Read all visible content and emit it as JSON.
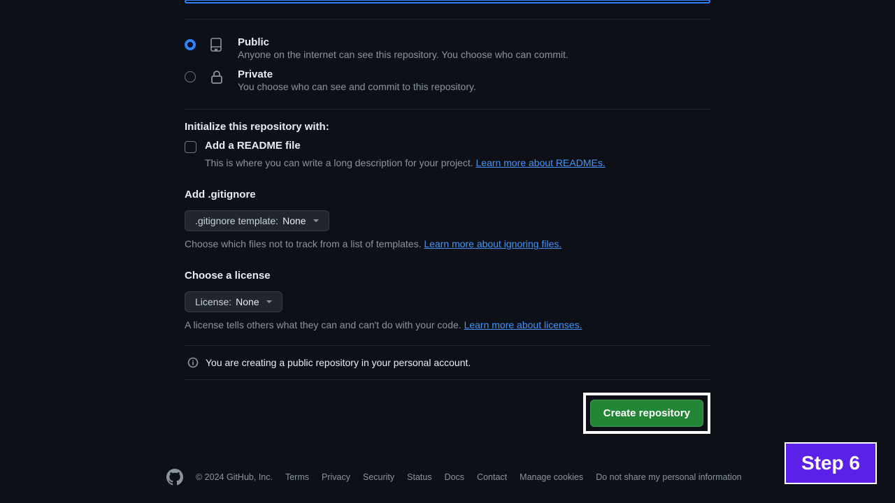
{
  "visibility": {
    "public": {
      "title": "Public",
      "desc": "Anyone on the internet can see this repository. You choose who can commit."
    },
    "private": {
      "title": "Private",
      "desc": "You choose who can see and commit to this repository."
    }
  },
  "init": {
    "heading": "Initialize this repository with:",
    "readme_label": "Add a README file",
    "readme_desc": "This is where you can write a long description for your project. ",
    "readme_link": "Learn more about READMEs."
  },
  "gitignore": {
    "heading": "Add .gitignore",
    "prefix": ".gitignore template: ",
    "value": "None",
    "desc": "Choose which files not to track from a list of templates. ",
    "link": "Learn more about ignoring files."
  },
  "license": {
    "heading": "Choose a license",
    "prefix": "License: ",
    "value": "None",
    "desc": "A license tells others what they can and can't do with your code. ",
    "link": "Learn more about licenses."
  },
  "info_banner": "You are creating a public repository in your personal account.",
  "submit_label": "Create repository",
  "footer": {
    "copyright": "© 2024 GitHub, Inc.",
    "links": [
      "Terms",
      "Privacy",
      "Security",
      "Status",
      "Docs",
      "Contact",
      "Manage cookies",
      "Do not share my personal information"
    ]
  },
  "step_badge": "Step 6"
}
